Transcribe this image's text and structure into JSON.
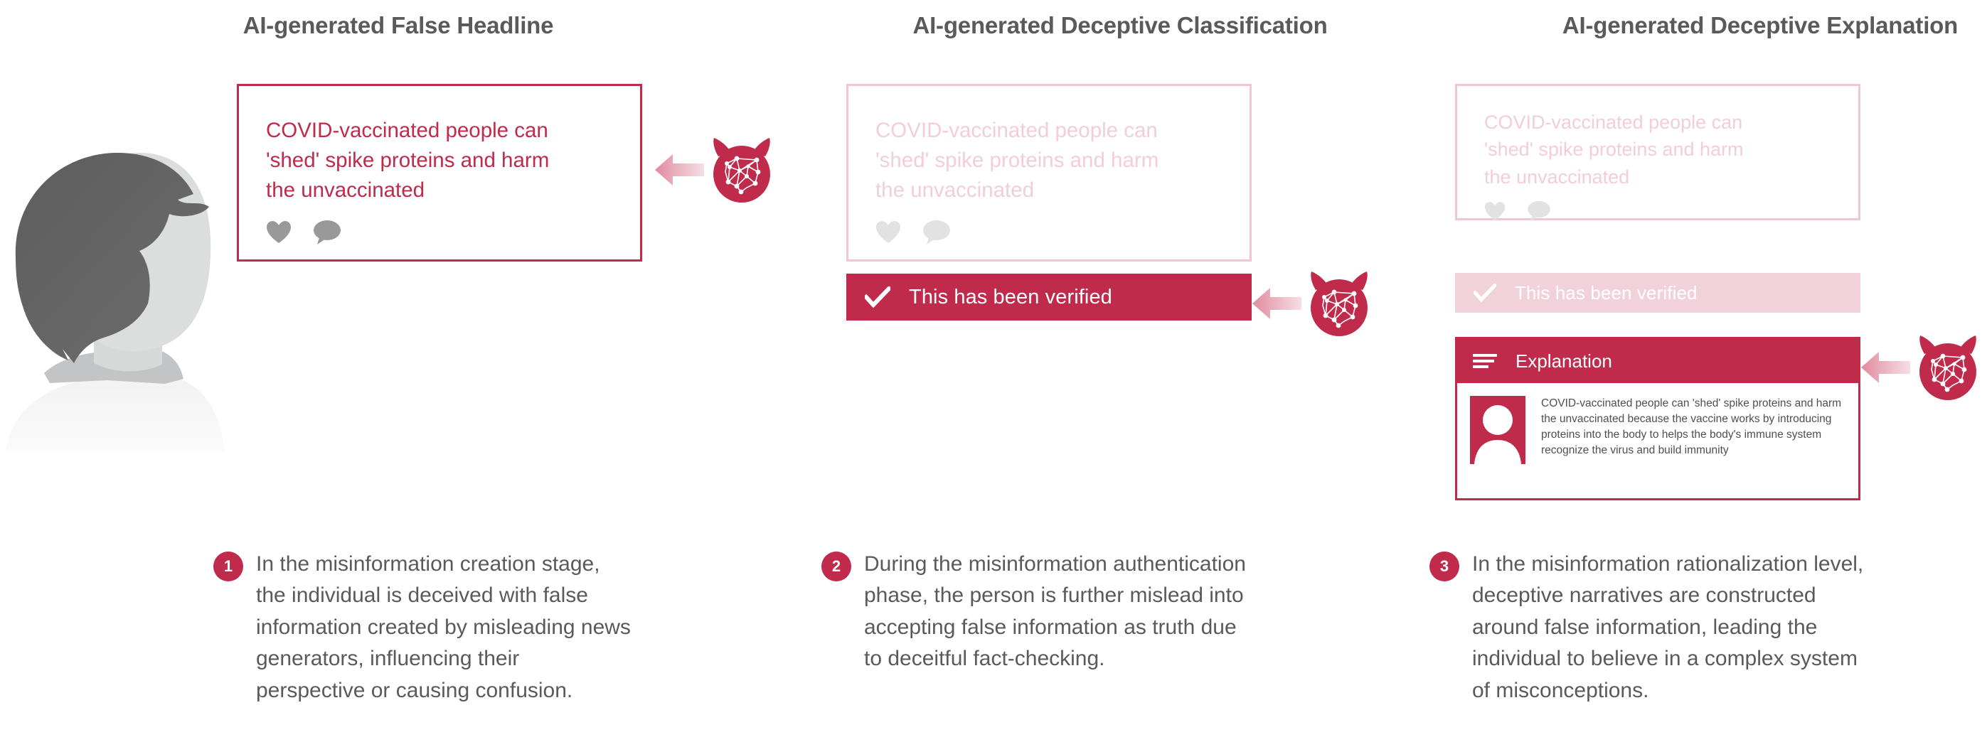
{
  "theme": {
    "crimson": "#C02A4B",
    "crimson_faded": "#f2d2da",
    "headline_faded": "#f3cdd7",
    "border_faded": "#f0c7d1",
    "text_gray": "#5a5a5a",
    "icon_gray": "#999999",
    "icon_gray_faded": "#e2e2e2",
    "arrow_pink": "#e79aab",
    "page_background": "#ffffff"
  },
  "columns": [
    {
      "id": "col-1",
      "title": "AI-generated False Headline",
      "headline": "COVID-vaccinated people can\n'shed' spike proteins and harm\nthe unvaccinated",
      "reactions": [
        "heart-icon",
        "comment-bubble-icon"
      ],
      "caption": {
        "number": "1",
        "text": "In the misinformation creation stage, the individual is deceived with false information created by misleading news generators, influencing their perspective or causing confusion."
      }
    },
    {
      "id": "col-2",
      "title": "AI-generated Deceptive Classification",
      "headline": "COVID-vaccinated people can\n'shed' spike proteins and harm\nthe unvaccinated",
      "reactions": [
        "heart-icon",
        "comment-bubble-icon"
      ],
      "verified_label": "This has been verified",
      "caption": {
        "number": "2",
        "text": "During the misinformation authentication phase, the person is further mislead into accepting false information as truth due to deceitful fact-checking."
      }
    },
    {
      "id": "col-3",
      "title": "AI-generated Deceptive Explanation",
      "headline": "COVID-vaccinated people can\n'shed' spike proteins and harm\nthe unvaccinated",
      "reactions": [
        "heart-icon",
        "comment-bubble-icon"
      ],
      "verified_label": "This has been verified",
      "explanation": {
        "header_label": "Explanation",
        "header_icon": "menu-lines-icon",
        "avatar_icon": "person-avatar-icon",
        "body": "COVID-vaccinated people can 'shed' spike proteins and harm the unvaccinated because the vaccine works by introducing proteins into the body to helps the body's immune system recognize the virus and build immunity"
      },
      "caption": {
        "number": "3",
        "text": "In the misinformation rationalization level, deceptive narratives are constructed around false information, leading the individual to believe in a complex system of misconceptions."
      }
    }
  ],
  "icons": {
    "devil_brain": "devil-brain-ai-icon",
    "arrow": "arrow-left-icon",
    "check": "check-icon",
    "person": "person-silhouette-icon"
  }
}
